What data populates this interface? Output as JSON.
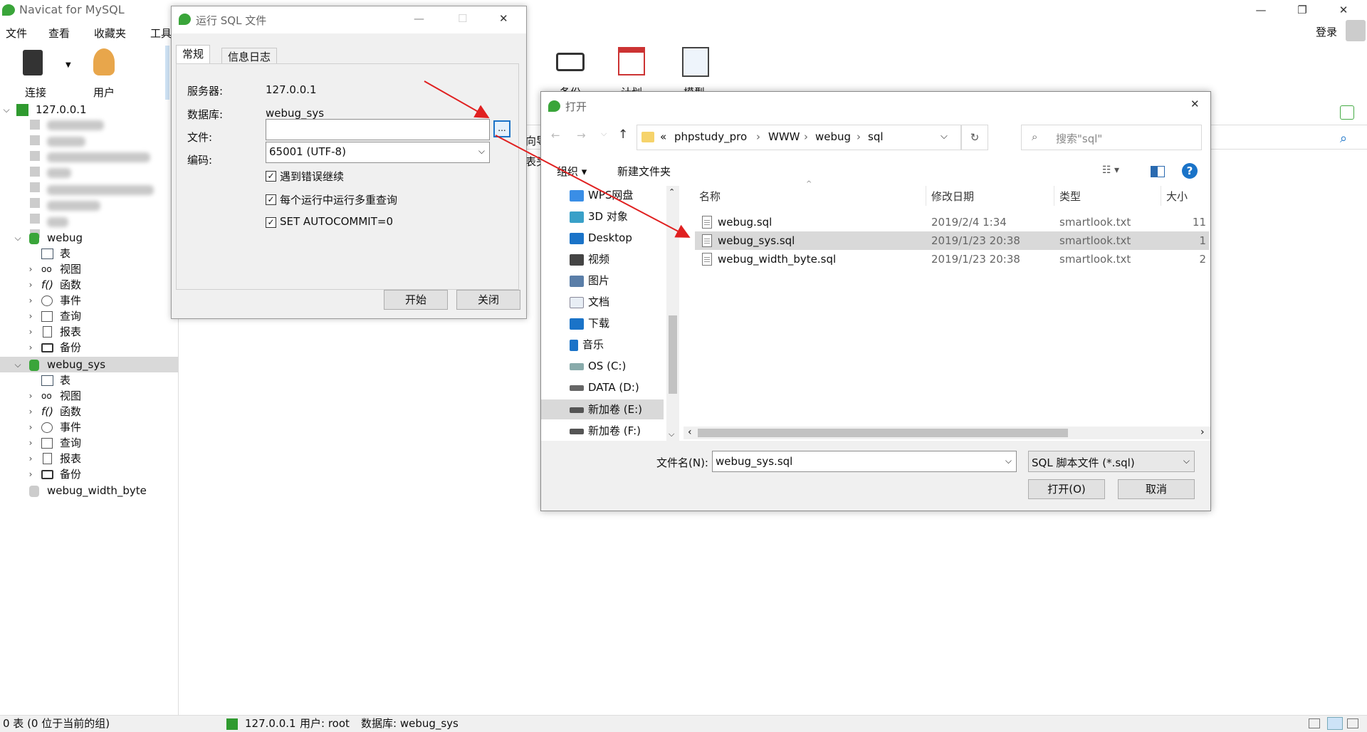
{
  "app": {
    "title": "Navicat for MySQL",
    "login": "登录"
  },
  "menu": [
    "文件",
    "查看",
    "收藏夹",
    "工具"
  ],
  "toolbar": {
    "connect": "连接",
    "user": "用户",
    "backup": "备份",
    "schedule": "计划",
    "model": "模型"
  },
  "tree": {
    "server": "127.0.0.1",
    "db1": {
      "name": "webug",
      "items": [
        "表",
        "视图",
        "函数",
        "事件",
        "查询",
        "报表",
        "备份"
      ]
    },
    "db2": {
      "name": "webug_sys",
      "items": [
        "表",
        "视图",
        "函数",
        "事件",
        "查询",
        "报表",
        "备份"
      ]
    },
    "db3": {
      "name": "webug_width_byte"
    }
  },
  "content": {
    "partial1": "向导",
    "partial2": "表头"
  },
  "status": {
    "left": "0 表 (0 位于当前的组)",
    "server": "127.0.0.1",
    "user": "用户: root",
    "db": "数据库: webug_sys"
  },
  "run_sql": {
    "title": "运行 SQL 文件",
    "tabs": [
      "常规",
      "信息日志"
    ],
    "server_label": "服务器:",
    "server": "127.0.0.1",
    "db_label": "数据库:",
    "db": "webug_sys",
    "file_label": "文件:",
    "file_value": "",
    "browse": "...",
    "enc_label": "编码:",
    "encoding": "65001 (UTF-8)",
    "opt1": "遇到错误继续",
    "opt2": "每个运行中运行多重查询",
    "opt3": "SET AUTOCOMMIT=0",
    "start": "开始",
    "close": "关闭"
  },
  "open_dialog": {
    "title": "打开",
    "path": [
      "«",
      "phpstudy_pro",
      "WWW",
      "webug",
      "sql"
    ],
    "search_placeholder": "搜索\"sql\"",
    "organize": "组织 ▾",
    "new_folder": "新建文件夹",
    "nav": [
      "WPS网盘",
      "3D 对象",
      "Desktop",
      "视频",
      "图片",
      "文档",
      "下载",
      "音乐",
      "OS (C:)",
      "DATA (D:)",
      "新加卷 (E:)",
      "新加卷 (F:)"
    ],
    "columns": [
      "名称",
      "修改日期",
      "类型",
      "大小"
    ],
    "files": [
      {
        "name": "webug.sql",
        "date": "2019/2/4 1:34",
        "type": "smartlook.txt",
        "size": "11"
      },
      {
        "name": "webug_sys.sql",
        "date": "2019/1/23 20:38",
        "type": "smartlook.txt",
        "size": "1"
      },
      {
        "name": "webug_width_byte.sql",
        "date": "2019/1/23 20:38",
        "type": "smartlook.txt",
        "size": "2"
      }
    ],
    "filename_label": "文件名(N):",
    "filename": "webug_sys.sql",
    "filter": "SQL 脚本文件 (*.sql)",
    "open": "打开(O)",
    "cancel": "取消"
  },
  "colors": {
    "accent": "#1a73c8",
    "arrow": "#e02020",
    "selection": "#d9d9d9",
    "dbgreen": "#3aa53a"
  }
}
